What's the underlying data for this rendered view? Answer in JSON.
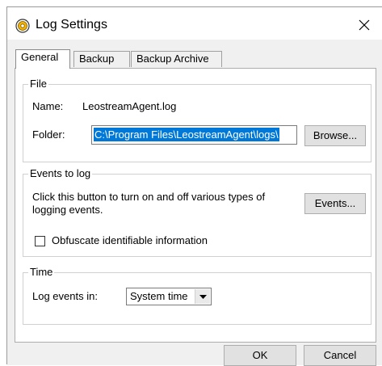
{
  "window": {
    "title": "Log Settings"
  },
  "tabs": [
    {
      "label": "General"
    },
    {
      "label": "Backup"
    },
    {
      "label": "Backup Archive"
    }
  ],
  "file_group": {
    "title": "File",
    "name_label": "Name:",
    "name_value": "LeostreamAgent.log",
    "folder_label": "Folder:",
    "folder_value": "C:\\Program Files\\LeostreamAgent\\logs\\",
    "browse_label": "Browse..."
  },
  "events_group": {
    "title": "Events to log",
    "description": "Click this button to turn on and off various types of logging events.",
    "events_button_label": "Events...",
    "obfuscate_label": "Obfuscate identifiable information",
    "obfuscate_checked": false
  },
  "time_group": {
    "title": "Time",
    "log_events_label": "Log events in:",
    "log_events_value": "System time"
  },
  "buttons": {
    "ok": "OK",
    "cancel": "Cancel"
  },
  "colors": {
    "selection": "#0078d7",
    "dialog_bg": "#f0f0f0",
    "button_bg": "#e1e1e1"
  }
}
